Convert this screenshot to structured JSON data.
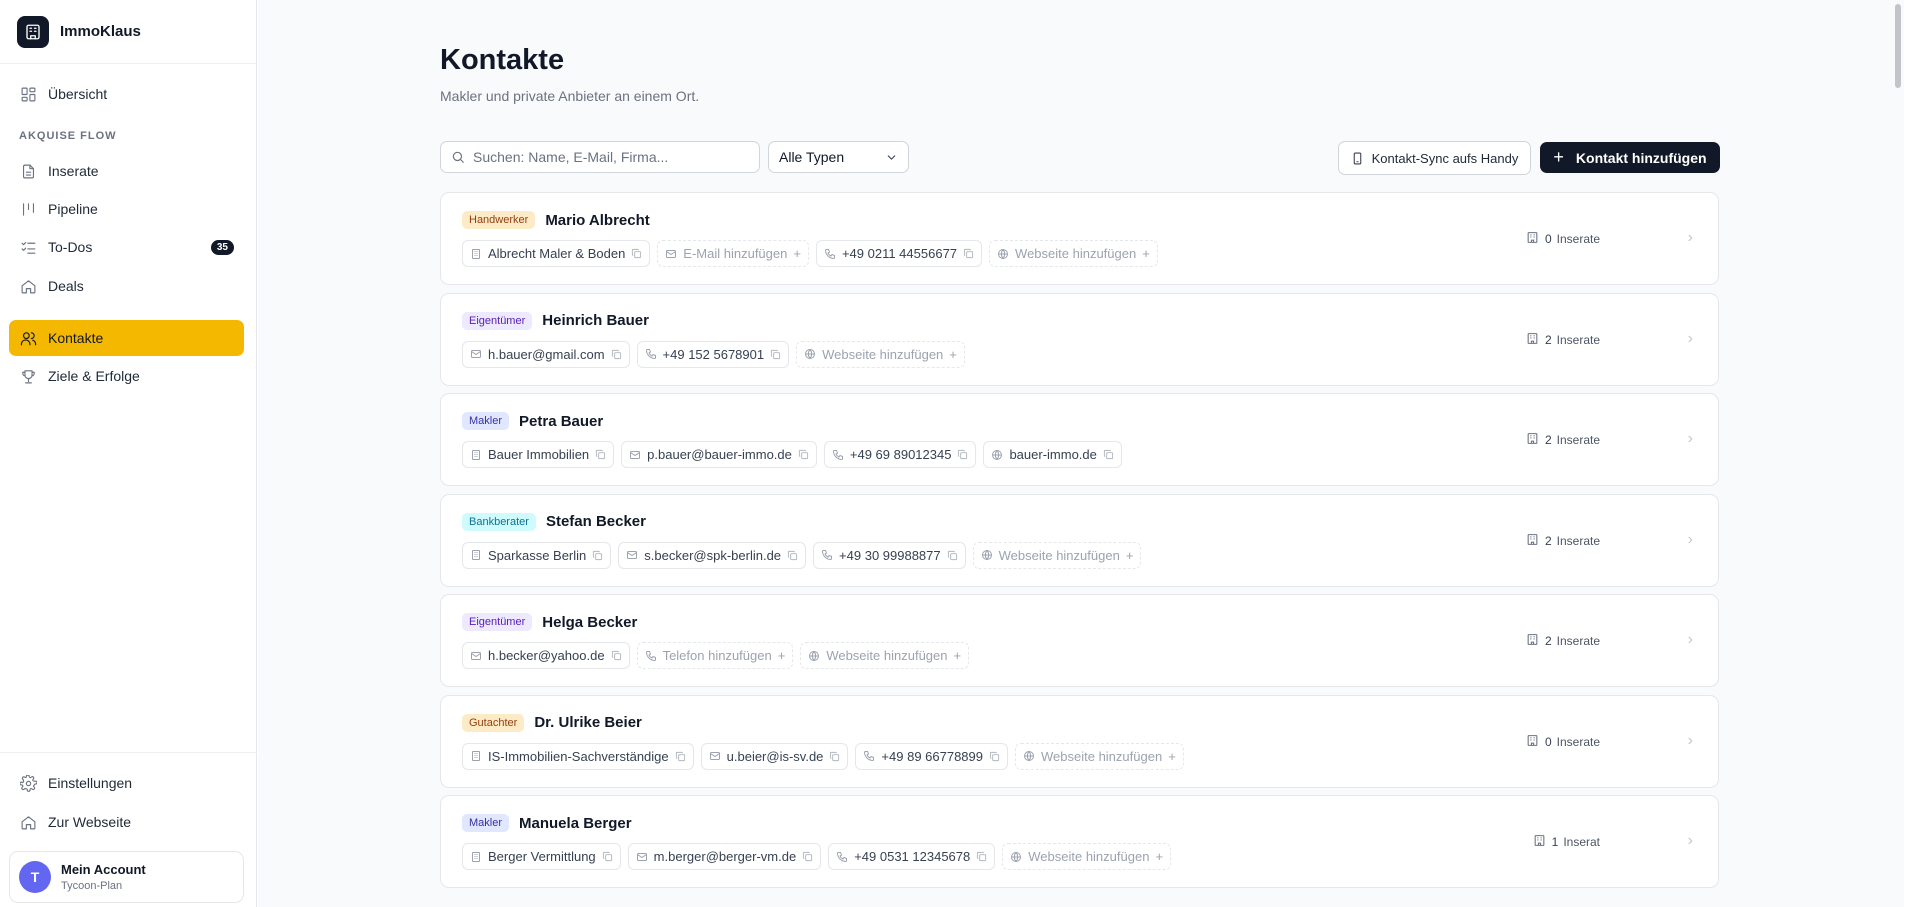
{
  "sidebar": {
    "brand": "ImmoKlaus",
    "overview": "Übersicht",
    "section_label": "AKQUISE FLOW",
    "items": [
      {
        "label": "Inserate",
        "icon": "document-icon"
      },
      {
        "label": "Pipeline",
        "icon": "pipeline-icon"
      },
      {
        "label": "To-Dos",
        "icon": "checklist-icon",
        "badge": "35"
      },
      {
        "label": "Deals",
        "icon": "house-icon"
      },
      {
        "label": "Kontakte",
        "icon": "users-icon",
        "active": true
      },
      {
        "label": "Ziele & Erfolge",
        "icon": "trophy-icon"
      }
    ],
    "settings": "Einstellungen",
    "website": "Zur Webseite",
    "account": {
      "initial": "T",
      "name": "Mein Account",
      "plan": "Tycoon-Plan"
    }
  },
  "main": {
    "title": "Kontakte",
    "subtitle": "Makler und private Anbieter an einem Ort.",
    "search_placeholder": "Suchen: Name, E-Mail, Firma...",
    "type_filter": "Alle Typen",
    "sync_button": "Kontakt-Sync aufs Handy",
    "add_button": "Kontakt hinzufügen"
  },
  "contacts": [
    {
      "type": "Handwerker",
      "name": "Mario Albrecht",
      "company": "Albrecht Maler & Boden",
      "email": "E-Mail hinzufügen",
      "phone": "+49 0211 44556677",
      "website": "Webseite hinzufügen",
      "listings_count": "0",
      "listings_label": "Inserate"
    },
    {
      "type": "Eigentümer",
      "name": "Heinrich Bauer",
      "email": "h.bauer@gmail.com",
      "phone": "+49 152 5678901",
      "website": "Webseite hinzufügen",
      "listings_count": "2",
      "listings_label": "Inserate"
    },
    {
      "type": "Makler",
      "name": "Petra Bauer",
      "company": "Bauer Immobilien",
      "email": "p.bauer@bauer-immo.de",
      "phone": "+49 69 89012345",
      "website": "bauer-immo.de",
      "listings_count": "2",
      "listings_label": "Inserate"
    },
    {
      "type": "Bankberater",
      "name": "Stefan Becker",
      "company": "Sparkasse Berlin",
      "email": "s.becker@spk-berlin.de",
      "phone": "+49 30 99988877",
      "website": "Webseite hinzufügen",
      "listings_count": "2",
      "listings_label": "Inserate"
    },
    {
      "type": "Eigentümer",
      "name": "Helga Becker",
      "email": "h.becker@yahoo.de",
      "phone": "Telefon hinzufügen",
      "website": "Webseite hinzufügen",
      "listings_count": "2",
      "listings_label": "Inserate"
    },
    {
      "type": "Gutachter",
      "name": "Dr. Ulrike Beier",
      "company": "IS-Immobilien-Sachverständige",
      "email": "u.beier@is-sv.de",
      "phone": "+49 89 66778899",
      "website": "Webseite hinzufügen",
      "listings_count": "0",
      "listings_label": "Inserate"
    },
    {
      "type": "Makler",
      "name": "Manuela Berger",
      "company": "Berger Vermittlung",
      "email": "m.berger@berger-vm.de",
      "phone": "+49 0531 12345678",
      "website": "Webseite hinzufügen",
      "listings_count": "1",
      "listings_label": "Inserat"
    }
  ],
  "colors": {
    "accent": "#f5b800",
    "primary_button": "#111827"
  }
}
